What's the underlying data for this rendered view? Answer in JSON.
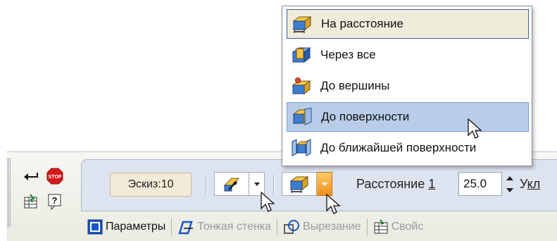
{
  "menu": {
    "items": [
      {
        "label": "На расстояние",
        "icon": "extrude-blind-icon"
      },
      {
        "label": "Через все",
        "icon": "extrude-through-all-icon"
      },
      {
        "label": "До вершины",
        "icon": "extrude-to-vertex-icon"
      },
      {
        "label": "До поверхности",
        "icon": "extrude-to-surface-icon"
      },
      {
        "label": "До ближайшей поверхности",
        "icon": "extrude-to-nearest-surface-icon"
      }
    ]
  },
  "panel": {
    "sketch_label": "Эскиз:10",
    "distance_label_prefix": "Расстояние ",
    "distance_label_index": "1",
    "distance_value": "25.0",
    "angle_label_prefix": "У",
    "angle_label_underlined": "кл",
    "tabs": [
      {
        "label": "Параметры",
        "icon": "parameters-icon"
      },
      {
        "label": "Тонкая стенка",
        "icon": "thin-wall-icon"
      },
      {
        "label": "Вырезание",
        "icon": "cut-icon"
      },
      {
        "label": "Свойс",
        "icon": "properties-icon"
      }
    ]
  },
  "colors": {
    "menu_hover": "#b9cde8",
    "menu_first": "#f0ecdc",
    "dropdown_arrow_active": "#f08f1a",
    "panel_inner": "#dde4ef"
  }
}
